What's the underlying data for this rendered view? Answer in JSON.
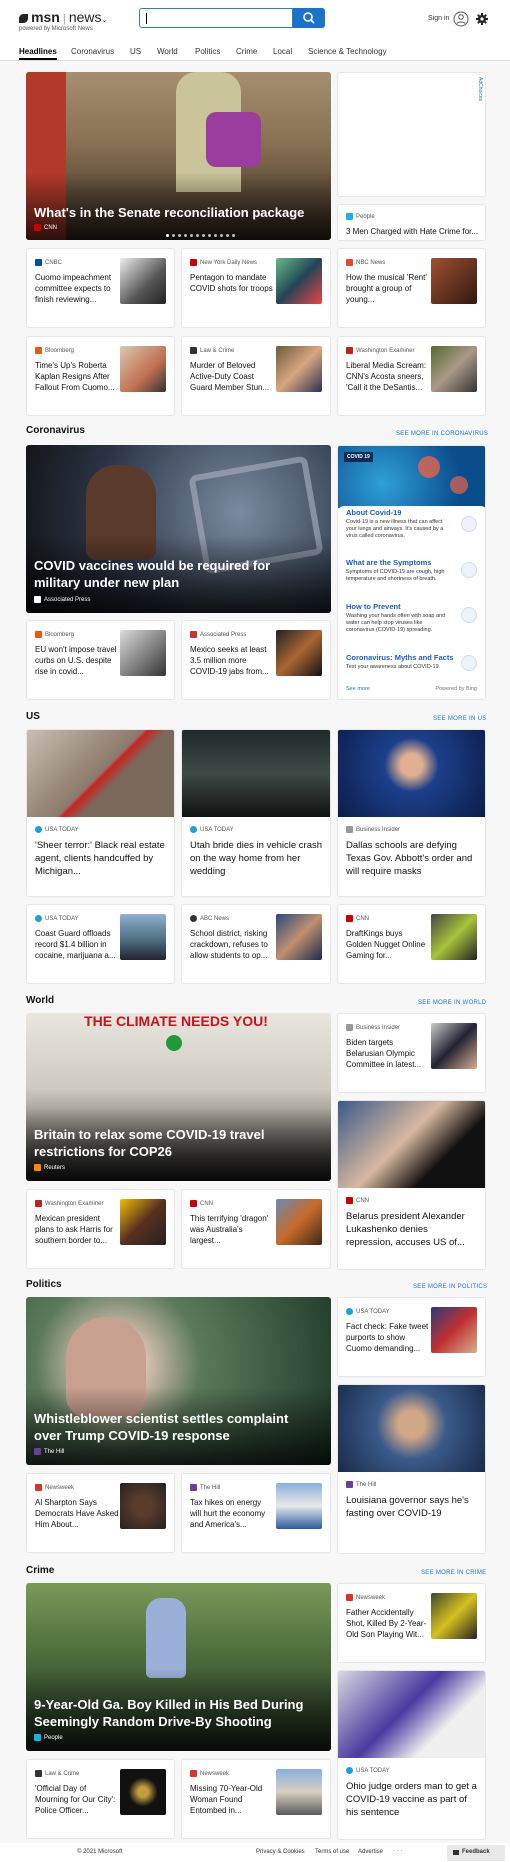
{
  "header": {
    "logo": "msn",
    "product": "news",
    "powered": "powered by Microsoft News",
    "search_placeholder": "",
    "signin": "Sign in"
  },
  "nav": [
    "Headlines",
    "Coronavirus",
    "US",
    "World",
    "Politics",
    "Crime",
    "Local",
    "Science & Technology"
  ],
  "ad_label": "AdChoices",
  "top": {
    "hero": {
      "title": "What's in the Senate reconciliation package",
      "source": "CNN"
    },
    "side": {
      "source": "People",
      "title": "3 Men Charged with Hate Crime for..."
    },
    "cards": [
      {
        "source": "CNBC",
        "title": "Cuomo impeachment committee expects to finish reviewing..."
      },
      {
        "source": "New York Daily News",
        "title": "Pentagon to mandate COVID shots for troops"
      },
      {
        "source": "NBC News",
        "title": "How the musical 'Rent' brought a group of young..."
      },
      {
        "source": "Bloomberg",
        "title": "Time's Up's Roberta Kaplan Resigns After Fallout From Cuomo..."
      },
      {
        "source": "Law & Crime",
        "title": "Murder of Beloved Active-Duty Coast Guard Member Stun..."
      },
      {
        "source": "Washington Examiner",
        "title": "Liberal Media Scream: CNN's Acosta sneers, 'Call it the DeSantis..."
      }
    ]
  },
  "coronavirus": {
    "heading": "Coronavirus",
    "seemore": "SEE MORE IN CORONAVIRUS",
    "hero": {
      "title": "COVID vaccines would be required for military under new plan",
      "source": "Associated Press"
    },
    "widget": {
      "badge": "COVID 19",
      "items": [
        {
          "title": "About Covid-19",
          "desc": "Covid-19 is a new illness that can affect your lungs and airways. It's caused by a virus called coronavirus."
        },
        {
          "title": "What are the Symptoms",
          "desc": "Symptoms of COVID-19 are cough, high temperature and shortness of breath."
        },
        {
          "title": "How to Prevent",
          "desc": "Washing your hands often with soap and water can help stop viruses like coronavirus (COVID-19) spreading."
        },
        {
          "title": "Coronavirus: Myths and Facts",
          "desc": "Test your awareness about COVID-19."
        }
      ],
      "see_more": "See more",
      "powered": "Powered by Bing"
    },
    "cards": [
      {
        "source": "Bloomberg",
        "title": "EU won't impose travel curbs on U.S. despite rise in covid..."
      },
      {
        "source": "Associated Press",
        "title": "Mexico seeks at least 3.5 million more COVID-19 jabs from..."
      }
    ]
  },
  "us": {
    "heading": "US",
    "seemore": "SEE MORE IN US",
    "big": [
      {
        "source": "USA TODAY",
        "title": "'Sheer terror:' Black real estate agent, clients handcuffed by Michigan..."
      },
      {
        "source": "USA TODAY",
        "title": "Utah bride dies in vehicle crash on the way home from her wedding"
      },
      {
        "source": "Business Insider",
        "title": "Dallas schools are defying Texas Gov. Abbott's order and will require masks"
      }
    ],
    "cards": [
      {
        "source": "USA TODAY",
        "title": "Coast Guard offloads record $1.4 billion in cocaine, marijuana a..."
      },
      {
        "source": "ABC News",
        "title": "School district, risking crackdown, refuses to allow students to op..."
      },
      {
        "source": "CNN",
        "title": "DraftKings buys Golden Nugget Online Gaming for..."
      }
    ]
  },
  "world": {
    "heading": "World",
    "seemore": "SEE MORE IN WORLD",
    "hero": {
      "title": "Britain to relax some COVID-19 travel restrictions for COP26",
      "source": "Reuters",
      "sign": "THE CLIMATE NEEDS YOU!"
    },
    "side": {
      "source": "Business Insider",
      "title": "Biden targets Belarusian Olympic Committee in latest..."
    },
    "side_big": {
      "source": "CNN",
      "title": "Belarus president Alexander Lukashenko denies repression, accuses US of..."
    },
    "cards": [
      {
        "source": "Washington Examiner",
        "title": "Mexican president plans to ask Harris for southern border to..."
      },
      {
        "source": "CNN",
        "title": "This terrifying 'dragon' was Australia's largest..."
      }
    ]
  },
  "politics": {
    "heading": "Politics",
    "seemore": "SEE MORE IN POLITICS",
    "hero": {
      "title": "Whistleblower scientist settles complaint over Trump COVID-19 response",
      "source": "The Hill"
    },
    "side": {
      "source": "USA TODAY",
      "title": "Fact check: Fake tweet purports to show Cuomo demanding..."
    },
    "side_big": {
      "source": "The Hill",
      "title": "Louisiana governor says he's fasting over COVID-19"
    },
    "cards": [
      {
        "source": "Newsweek",
        "title": "Al Sharpton Says Democrats Have Asked Him About..."
      },
      {
        "source": "The Hill",
        "title": "Tax hikes on energy will hurt the economy and America's..."
      }
    ]
  },
  "crime": {
    "heading": "Crime",
    "seemore": "SEE MORE IN CRIME",
    "hero": {
      "title": "9-Year-Old Ga. Boy Killed in His Bed During Seemingly Random Drive-By Shooting",
      "source": "People"
    },
    "side": {
      "source": "Newsweek",
      "title": "Father Accidentally Shot, Killed By 2-Year-Old Son Playing Wit..."
    },
    "side_big": {
      "source": "USA TODAY",
      "title": "Ohio judge orders man to get a COVID-19 vaccine as part of his sentence"
    },
    "cards": [
      {
        "source": "Law & Crime",
        "title": "'Official Day of Mourning for Our City': Police Officer..."
      },
      {
        "source": "Newsweek",
        "title": "Missing 70-Year-Old Woman Found Entombed in..."
      }
    ]
  },
  "footer": {
    "copyright": "© 2021 Microsoft",
    "privacy": "Privacy & Cookies",
    "terms": "Terms of use",
    "advertise": "Advertise",
    "more": "· · ·",
    "feedback": "Feedback"
  }
}
